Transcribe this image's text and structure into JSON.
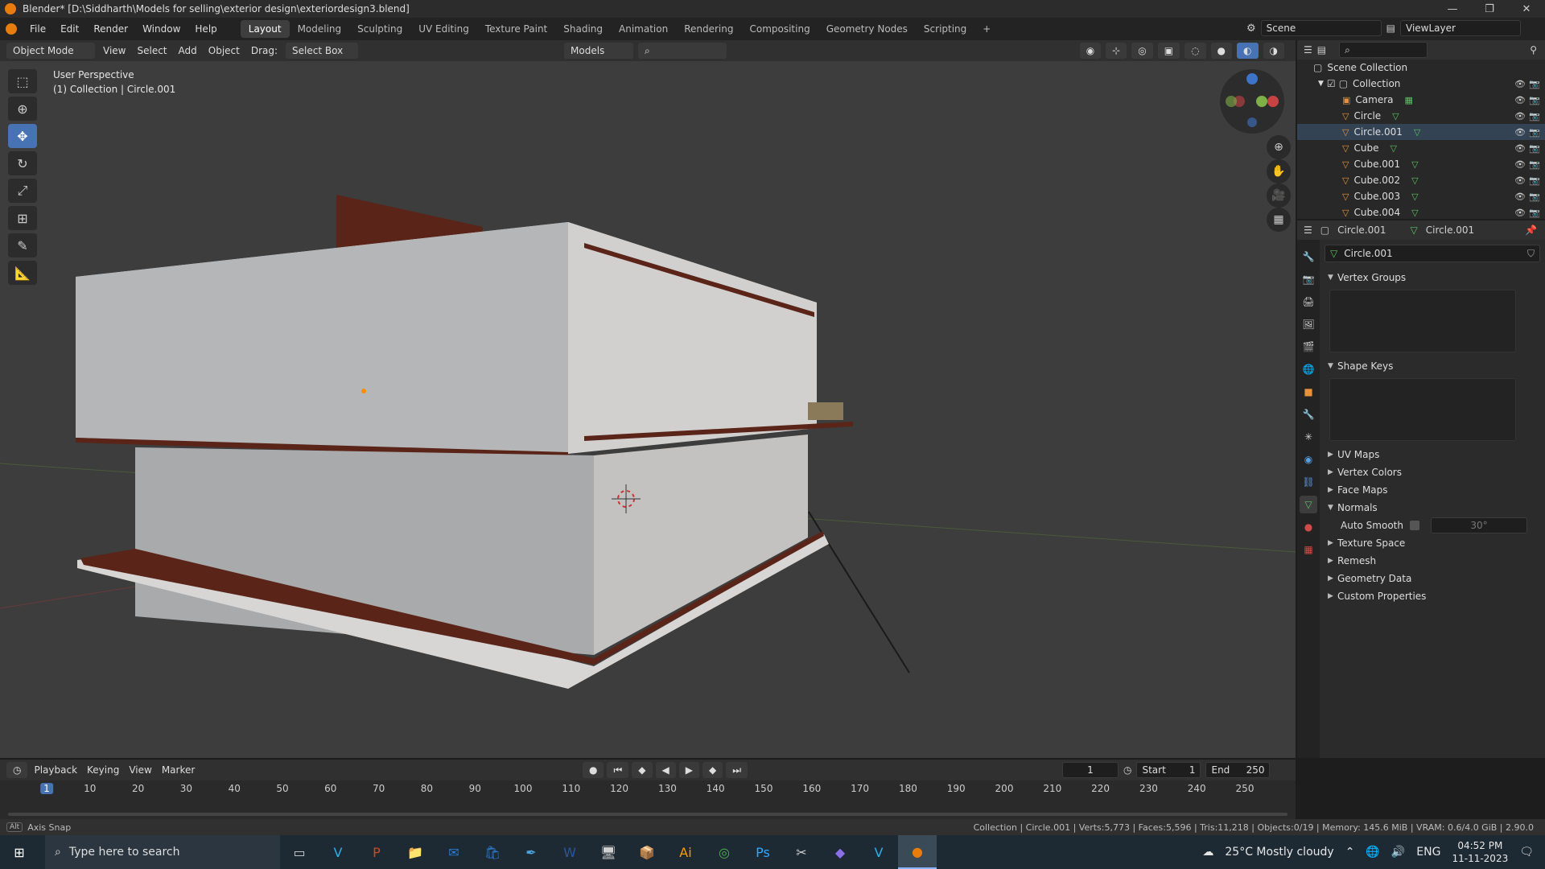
{
  "window": {
    "title": "Blender* [D:\\Siddharth\\Models for selling\\exterior design\\exteriordesign3.blend]",
    "min_glyph": "—",
    "max_glyph": "❐",
    "close_glyph": "✕"
  },
  "menubar": {
    "menus": [
      "File",
      "Edit",
      "Render",
      "Window",
      "Help"
    ],
    "workspaces": [
      "Layout",
      "Modeling",
      "Sculpting",
      "UV Editing",
      "Texture Paint",
      "Shading",
      "Animation",
      "Rendering",
      "Compositing",
      "Geometry Nodes",
      "Scripting"
    ],
    "active_workspace": "Layout",
    "add_workspace": "+",
    "scene": "Scene",
    "view_layer": "ViewLayer"
  },
  "viewport_header": {
    "mode": "Object Mode",
    "menus": [
      "View",
      "Select",
      "Add",
      "Object"
    ],
    "drag_label": "Drag:",
    "drag_value": "Select Box",
    "orientation": "Models"
  },
  "viewport": {
    "perspective_label": "User Perspective",
    "context_label": "(1) Collection | Circle.001"
  },
  "outliner": {
    "root": "Scene Collection",
    "collection": "Collection",
    "items": [
      {
        "name": "Camera",
        "type": "camera"
      },
      {
        "name": "Circle",
        "type": "mesh"
      },
      {
        "name": "Circle.001",
        "type": "mesh"
      },
      {
        "name": "Cube",
        "type": "mesh"
      },
      {
        "name": "Cube.001",
        "type": "mesh"
      },
      {
        "name": "Cube.002",
        "type": "mesh"
      },
      {
        "name": "Cube.003",
        "type": "mesh"
      },
      {
        "name": "Cube.004",
        "type": "mesh"
      }
    ]
  },
  "properties": {
    "object_name": "Circle.001",
    "data_name": "Circle.001",
    "mesh_field": "Circle.001",
    "sections": {
      "vertex_groups": "Vertex Groups",
      "shape_keys": "Shape Keys",
      "uv_maps": "UV Maps",
      "vertex_colors": "Vertex Colors",
      "face_maps": "Face Maps",
      "normals": "Normals",
      "texture_space": "Texture Space",
      "remesh": "Remesh",
      "geometry_data": "Geometry Data",
      "custom_properties": "Custom Properties"
    },
    "auto_smooth_label": "Auto Smooth",
    "auto_smooth_angle": "30°"
  },
  "timeline": {
    "menus": [
      "Playback",
      "Keying",
      "View",
      "Marker"
    ],
    "current_frame": "1",
    "start_label": "Start",
    "start": "1",
    "end_label": "End",
    "end": "250",
    "ticks": [
      "1",
      "10",
      "20",
      "30",
      "40",
      "50",
      "60",
      "70",
      "80",
      "90",
      "100",
      "110",
      "120",
      "130",
      "140",
      "150",
      "160",
      "170",
      "180",
      "190",
      "200",
      "210",
      "220",
      "230",
      "240",
      "250"
    ]
  },
  "statusbar": {
    "left_key": "Alt",
    "left": "Axis Snap",
    "right": "Collection | Circle.001 | Verts:5,773 | Faces:5,596 | Tris:11,218 | Objects:0/19 | Memory: 145.6 MiB | VRAM: 0.6/4.0 GiB | 2.90.0"
  },
  "taskbar": {
    "search_placeholder": "Type here to search",
    "weather": "25°C  Mostly cloudy",
    "language": "ENG",
    "time": "04:52 PM",
    "date": "11-11-2023"
  },
  "colors": {
    "accent": "#4772b3",
    "blender_orange": "#e87d0d",
    "mesh_icon": "#e8913a",
    "data_icon": "#5cc060",
    "viewport_bg": "#3d3d3d",
    "panel_bg": "#2b2b2b"
  }
}
